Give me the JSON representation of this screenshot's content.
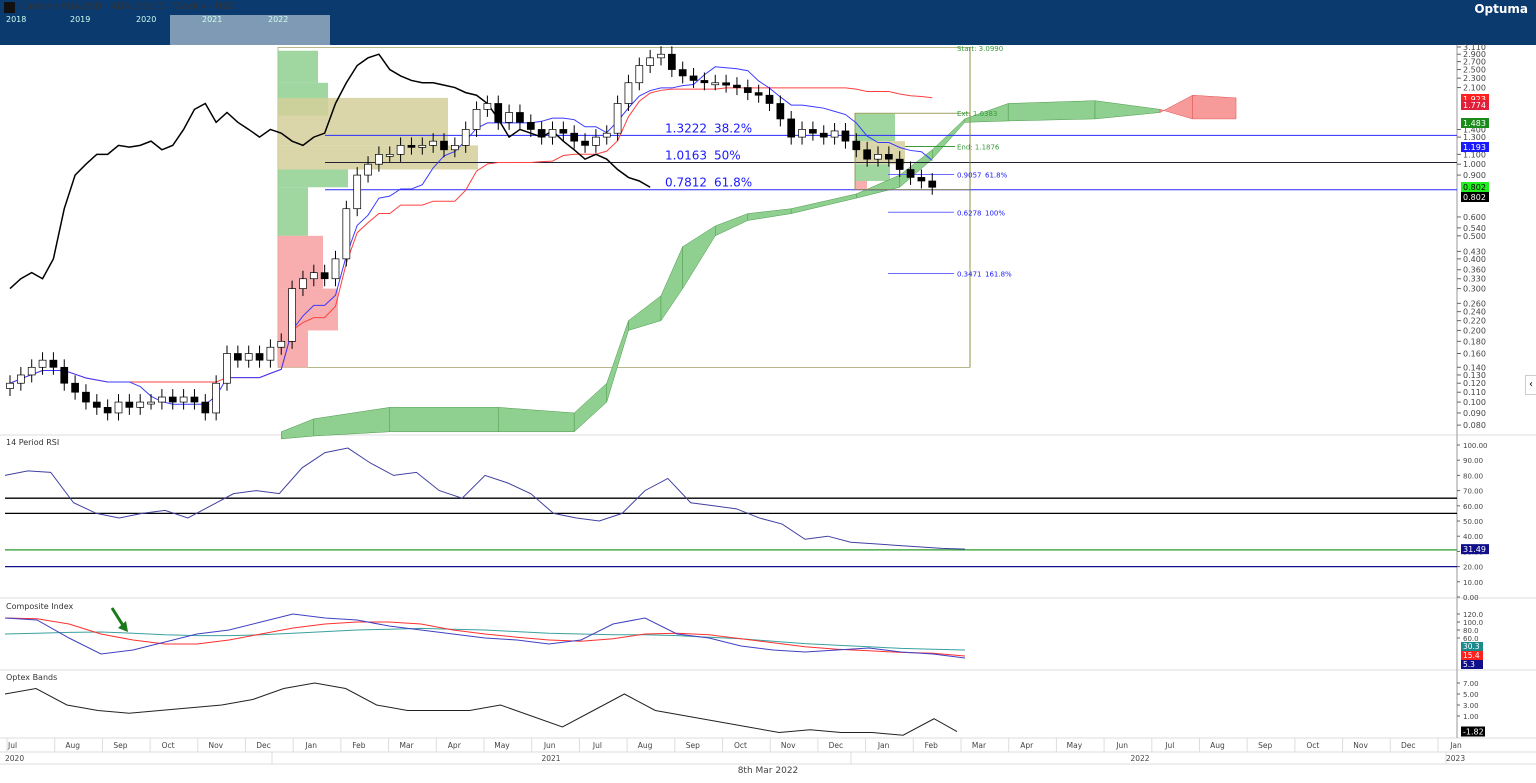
{
  "header": {
    "title": "Cardano ADA/USD - ADAUSD:CC - Weekly - USD",
    "brand": "Optuma",
    "navigator_years": [
      "2018",
      "2019",
      "2020",
      "2021",
      "2022"
    ]
  },
  "footer": {
    "date": "8th Mar 2022"
  },
  "chart_data": {
    "type": "candlestick",
    "price_axis": {
      "scale": "log",
      "ticks": [
        "3.110",
        "2.900",
        "2.700",
        "2.500",
        "2.300",
        "2.100",
        "1.400",
        "1.300",
        "1.100",
        "1.000",
        "0.900",
        "0.600",
        "0.540",
        "0.500",
        "0.430",
        "0.400",
        "0.360",
        "0.330",
        "0.300",
        "0.260",
        "0.240",
        "0.220",
        "0.200",
        "0.180",
        "0.160",
        "0.140",
        "0.130",
        "0.120",
        "0.110",
        "0.100",
        "0.090",
        "0.080"
      ]
    },
    "price_tags": [
      {
        "label": "1.923",
        "color": "#ff2020"
      },
      {
        "label": "1.774",
        "color": "#e0203a"
      },
      {
        "label": "1.483",
        "color": "#1a8a1a"
      },
      {
        "label": "1.193",
        "color": "#1a1aff"
      },
      {
        "label": "0.802",
        "color": "#22ee22"
      },
      {
        "label": "0.802",
        "color": "#000000"
      }
    ],
    "weekly_closes": [
      0.12,
      0.13,
      0.14,
      0.15,
      0.14,
      0.12,
      0.11,
      0.1,
      0.095,
      0.09,
      0.1,
      0.095,
      0.1,
      0.1,
      0.105,
      0.1,
      0.105,
      0.1,
      0.09,
      0.12,
      0.16,
      0.15,
      0.16,
      0.15,
      0.17,
      0.18,
      0.3,
      0.33,
      0.35,
      0.33,
      0.4,
      0.65,
      0.9,
      1.0,
      1.1,
      1.1,
      1.2,
      1.18,
      1.2,
      1.25,
      1.15,
      1.2,
      1.4,
      1.7,
      1.8,
      1.5,
      1.65,
      1.5,
      1.4,
      1.3,
      1.4,
      1.35,
      1.25,
      1.2,
      1.3,
      1.35,
      1.8,
      2.2,
      2.6,
      2.8,
      2.9,
      2.5,
      2.35,
      2.25,
      2.2,
      2.2,
      2.15,
      2.1,
      2.0,
      1.95,
      1.8,
      1.55,
      1.3,
      1.4,
      1.35,
      1.3,
      1.38,
      1.25,
      1.15,
      1.05,
      1.1,
      1.05,
      0.95,
      0.88,
      0.85,
      0.8
    ],
    "cloud": {
      "weeks": [
        25,
        28,
        35,
        45,
        52,
        55,
        57,
        60,
        62,
        65,
        68,
        72,
        78,
        82,
        85,
        88,
        92,
        100,
        106,
        109,
        113
      ],
      "span_a": [
        0.075,
        0.085,
        0.095,
        0.095,
        0.09,
        0.12,
        0.22,
        0.28,
        0.45,
        0.55,
        0.62,
        0.65,
        0.75,
        0.9,
        1.15,
        1.55,
        1.8,
        1.85,
        1.7,
        1.55,
        1.55
      ],
      "span_b": [
        0.07,
        0.072,
        0.075,
        0.075,
        0.075,
        0.1,
        0.2,
        0.22,
        0.3,
        0.5,
        0.58,
        0.62,
        0.72,
        0.8,
        1.05,
        1.5,
        1.52,
        1.55,
        1.65,
        1.95,
        1.9
      ]
    },
    "fib_major": [
      {
        "value": 1.3222,
        "label": "1.3222",
        "pct": "38.2%"
      },
      {
        "value": 1.0163,
        "label": "1.0163",
        "pct": "50%"
      },
      {
        "value": 0.7812,
        "label": "0.7812",
        "pct": "61.8%"
      }
    ],
    "fib_ext": [
      {
        "value": 0.9057,
        "label": "0.9057",
        "pct": "61.8%"
      },
      {
        "value": 0.6278,
        "label": "0.6278",
        "pct": "100%"
      },
      {
        "value": 0.3471,
        "label": "0.3471",
        "pct": "161.8%"
      }
    ],
    "annotations": {
      "start": "Start: 3.0990",
      "ext": "Ext: 1.6383",
      "end": "End: 1.1876"
    },
    "rsi": {
      "title": "14 Period RSI",
      "ticks": [
        "100.00",
        "90.00",
        "80.00",
        "70.00",
        "60.00",
        "50.00",
        "40.00",
        "30.00",
        "20.00",
        "10.00",
        "0.00"
      ],
      "tag": "31.49",
      "levels": [
        65,
        55,
        31,
        20
      ],
      "values": [
        80,
        83,
        82,
        62,
        55,
        52,
        55,
        57,
        52,
        60,
        68,
        70,
        68,
        85,
        95,
        98,
        88,
        80,
        82,
        70,
        65,
        80,
        75,
        68,
        55,
        52,
        50,
        55,
        70,
        78,
        62,
        60,
        58,
        52,
        48,
        38,
        40,
        36,
        35,
        34,
        33,
        32,
        31.49
      ]
    },
    "composite": {
      "title": "Composite Index",
      "ticks": [
        "120.0",
        "100.0",
        "80.0",
        "60.0"
      ],
      "tags": [
        {
          "label": "30.3",
          "color": "#1a8a8a"
        },
        {
          "label": "15.4",
          "color": "#ff2020"
        },
        {
          "label": "5.3",
          "color": "#10108a"
        }
      ],
      "index": [
        110,
        105,
        60,
        20,
        30,
        50,
        70,
        80,
        100,
        120,
        110,
        105,
        90,
        80,
        70,
        60,
        55,
        45,
        55,
        95,
        110,
        70,
        60,
        40,
        30,
        25,
        30,
        35,
        25,
        20,
        10
      ],
      "fast_ma": [
        110,
        108,
        95,
        70,
        55,
        45,
        45,
        55,
        70,
        85,
        95,
        100,
        100,
        95,
        80,
        70,
        62,
        55,
        52,
        58,
        70,
        72,
        68,
        58,
        48,
        38,
        32,
        28,
        24,
        22,
        15
      ],
      "slow_ma": [
        70,
        72,
        74,
        75,
        72,
        68,
        66,
        66,
        68,
        72,
        76,
        80,
        82,
        84,
        82,
        80,
        76,
        72,
        70,
        68,
        68,
        66,
        62,
        58,
        52,
        46,
        42,
        38,
        34,
        32,
        30
      ]
    },
    "optex": {
      "title": "Optex Bands",
      "ticks": [
        "7.00",
        "5.00",
        "3.00",
        "1.00"
      ],
      "tag": "-1.82",
      "values": [
        5,
        6,
        3,
        2,
        1.5,
        2,
        2.5,
        3,
        4,
        6,
        7,
        6,
        3,
        2,
        2,
        2,
        3,
        1,
        -1,
        2,
        5,
        2,
        1,
        0,
        -1,
        -2,
        -1.5,
        -2,
        -2,
        -2.5,
        0.5,
        -1.82
      ]
    },
    "time_axis": {
      "months": [
        "Jul",
        "Aug",
        "Sep",
        "Oct",
        "Nov",
        "Dec",
        "Jan",
        "Feb",
        "Mar",
        "Apr",
        "May",
        "Jun",
        "Jul",
        "Aug",
        "Sep",
        "Oct",
        "Nov",
        "Dec",
        "Jan",
        "Feb",
        "Mar",
        "Apr",
        "May",
        "Jun",
        "Jul",
        "Aug",
        "Sep",
        "Oct",
        "Nov",
        "Dec",
        "Jan"
      ],
      "years": [
        "2020",
        "2021",
        "2022",
        "2023"
      ]
    }
  }
}
